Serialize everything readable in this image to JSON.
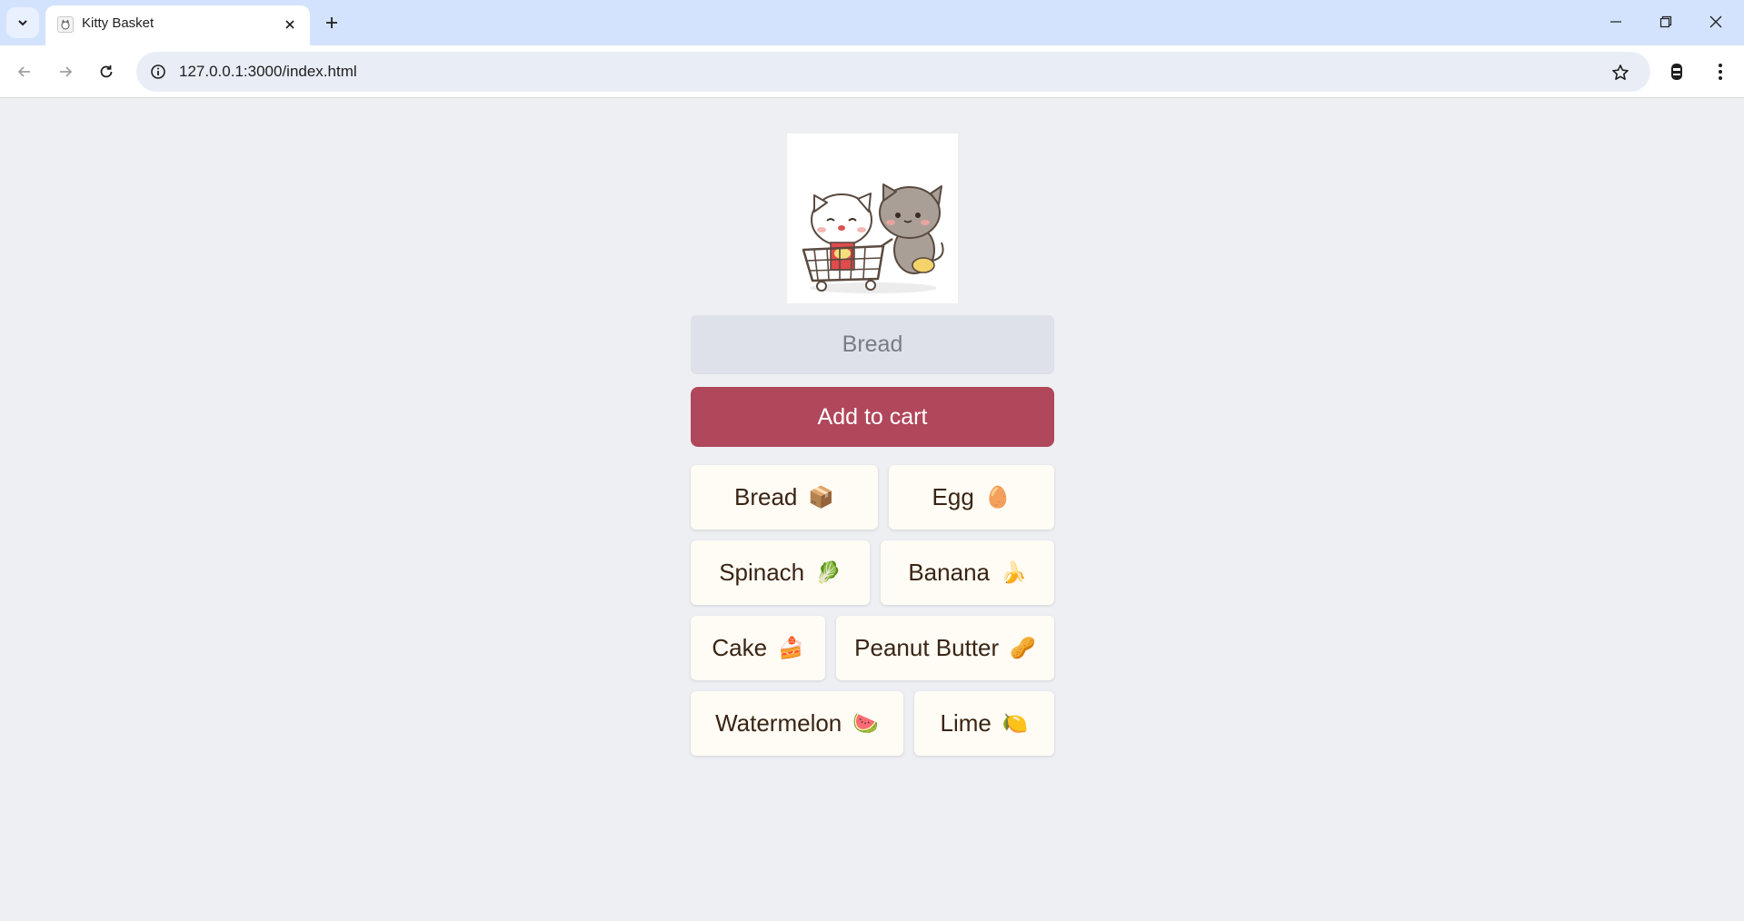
{
  "browser": {
    "tab_title": "Kitty Basket",
    "url": "127.0.0.1:3000/index.html"
  },
  "page": {
    "input_placeholder": "Bread",
    "add_button_label": "Add to cart",
    "items": [
      {
        "label": "Bread",
        "emoji": "📦"
      },
      {
        "label": "Egg",
        "emoji": "🥚"
      },
      {
        "label": "Spinach",
        "emoji": "🥬"
      },
      {
        "label": "Banana",
        "emoji": "🍌"
      },
      {
        "label": "Cake",
        "emoji": "🍰"
      },
      {
        "label": "Peanut Butter",
        "emoji": "🥜"
      },
      {
        "label": "Watermelon",
        "emoji": "🍉"
      },
      {
        "label": "Lime",
        "emoji": "🍋"
      }
    ]
  },
  "colors": {
    "accent": "#b0475b",
    "item_bg": "#fefcf5",
    "page_bg": "#eeeff3"
  }
}
